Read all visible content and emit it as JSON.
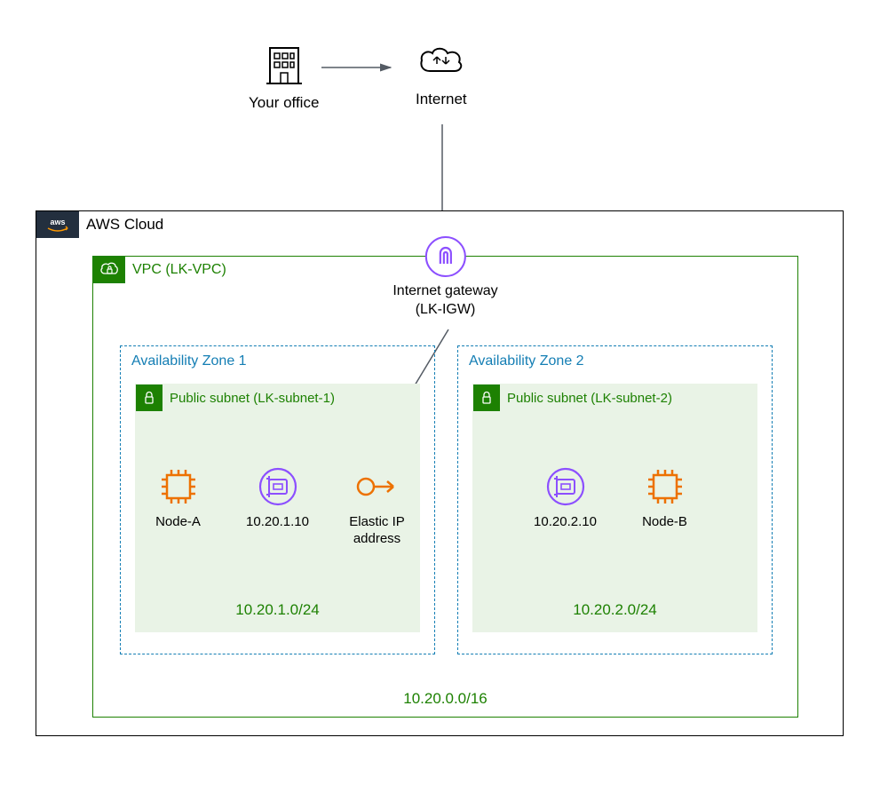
{
  "top": {
    "office_label": "Your office",
    "internet_label": "Internet"
  },
  "cloud": {
    "label": "AWS Cloud"
  },
  "vpc": {
    "label": "VPC (LK-VPC)",
    "cidr": "10.20.0.0/16"
  },
  "igw": {
    "label_line1": "Internet gateway",
    "label_line2": "(LK-IGW)"
  },
  "az1": {
    "label": "Availability Zone 1",
    "subnet_label": "Public subnet (LK-subnet-1)",
    "subnet_cidr": "10.20.1.0/24",
    "nodeA": "Node-A",
    "eni_ip": "10.20.1.10",
    "eip": "Elastic IP",
    "eip2": "address"
  },
  "az2": {
    "label": "Availability Zone 2",
    "subnet_label": "Public subnet (LK-subnet-2)",
    "subnet_cidr": "10.20.2.0/24",
    "eni_ip": "10.20.2.10",
    "nodeB": "Node-B"
  }
}
